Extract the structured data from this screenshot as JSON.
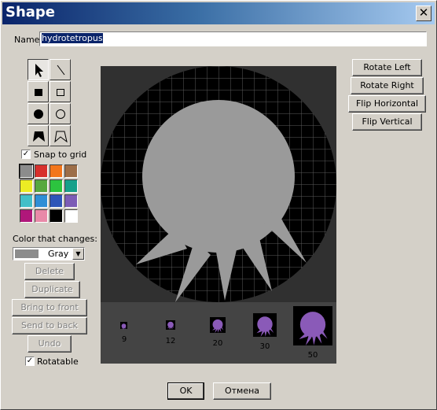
{
  "window": {
    "title": "Shape",
    "close_glyph": "✕"
  },
  "name_field": {
    "label": "Name",
    "value": "hydrotetropus"
  },
  "tools": [
    {
      "name": "select-tool-icon",
      "active": true
    },
    {
      "name": "line-tool-icon",
      "active": false
    },
    {
      "name": "filled-rect-tool-icon",
      "active": false
    },
    {
      "name": "rect-tool-icon",
      "active": false
    },
    {
      "name": "filled-ellipse-tool-icon",
      "active": false
    },
    {
      "name": "ellipse-tool-icon",
      "active": false
    },
    {
      "name": "filled-polygon-tool-icon",
      "active": false
    },
    {
      "name": "polygon-tool-icon",
      "active": false
    }
  ],
  "snap_to_grid": {
    "label": "Snap to grid",
    "checked": true,
    "check_glyph": "✓"
  },
  "palette": {
    "colors": [
      "#8c8c8c",
      "#d7302c",
      "#f3761b",
      "#9d6e48",
      "#ecec24",
      "#57a83f",
      "#2cc43f",
      "#16a08a",
      "#42bfc8",
      "#2f8fd6",
      "#2e55b8",
      "#7c5cb6",
      "#b0177a",
      "#e889a8",
      "#000000",
      "#ffffff"
    ],
    "selected_index": 0
  },
  "color_that_changes": {
    "label": "Color that changes:",
    "value": "Gray",
    "arrow_glyph": "▼"
  },
  "actions": {
    "delete": "Delete",
    "duplicate": "Duplicate",
    "bring_to_front": "Bring to front",
    "send_to_back": "Send to back",
    "undo": "Undo"
  },
  "rotatable": {
    "label": "Rotatable",
    "checked": true,
    "check_glyph": "✓"
  },
  "transform": {
    "rotate_left": "Rotate Left",
    "rotate_right": "Rotate Right",
    "flip_horizontal": "Flip Horizontal",
    "flip_vertical": "Flip Vertical"
  },
  "previews": [
    {
      "size": "9"
    },
    {
      "size": "12"
    },
    {
      "size": "20"
    },
    {
      "size": "30"
    },
    {
      "size": "50"
    }
  ],
  "colors": {
    "shape_fill": "#9a9a9a",
    "preview_fill": "#8a5ab8",
    "canvas_circle": "#000000",
    "grid": "#5a5a5a"
  },
  "footer": {
    "ok": "OK",
    "cancel": "Отмена"
  }
}
